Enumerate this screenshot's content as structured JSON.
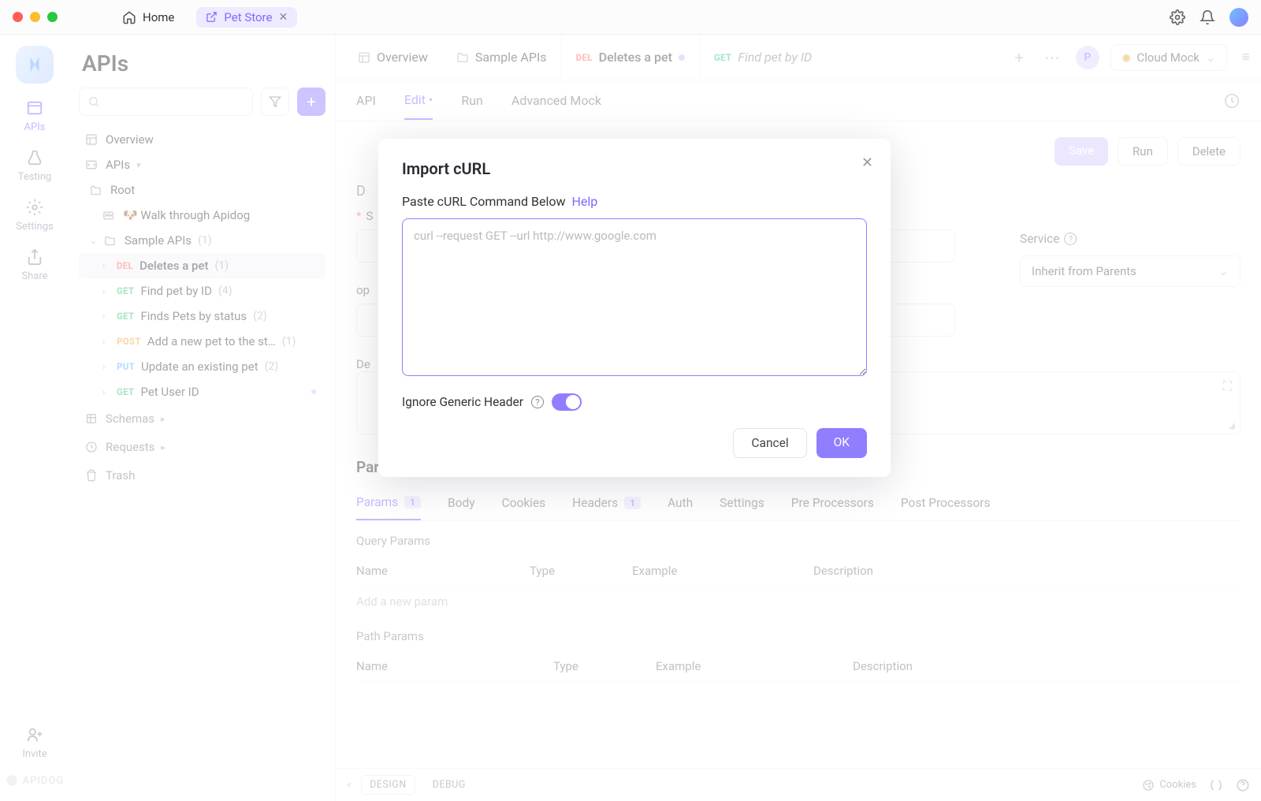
{
  "titlebar": {
    "home": "Home",
    "tab": "Pet Store"
  },
  "iconbar": {
    "apis": "APIs",
    "testing": "Testing",
    "settings": "Settings",
    "share": "Share",
    "invite": "Invite",
    "brand": "APIDOG"
  },
  "sidebar": {
    "title": "APIs",
    "overview": "Overview",
    "apis_label": "APIs",
    "root": "Root",
    "walkthrough": "🐶 Walk through Apidog",
    "sample": {
      "label": "Sample APIs",
      "count": "(1)"
    },
    "endpoints": [
      {
        "method": "DEL",
        "cls": "del",
        "name": "Deletes a pet",
        "count": "(1)",
        "active": true
      },
      {
        "method": "GET",
        "cls": "get",
        "name": "Find pet by ID",
        "count": "(4)"
      },
      {
        "method": "GET",
        "cls": "get",
        "name": "Finds Pets by status",
        "count": "(2)"
      },
      {
        "method": "POST",
        "cls": "post",
        "name": "Add a new pet to the st…",
        "count": "(1)"
      },
      {
        "method": "PUT",
        "cls": "put",
        "name": "Update an existing pet",
        "count": "(2)"
      },
      {
        "method": "GET",
        "cls": "get",
        "name": "Pet User ID",
        "count": "",
        "dot": true
      }
    ],
    "schemas": "Schemas",
    "requests": "Requests",
    "trash": "Trash"
  },
  "tabs": {
    "overview": "Overview",
    "sample": "Sample APIs",
    "del": {
      "m": "DEL",
      "name": "Deletes a pet"
    },
    "get": {
      "m": "GET",
      "name": "Find pet by ID"
    },
    "cloud": "Cloud Mock",
    "avatar": "P"
  },
  "subtabs": {
    "api": "API",
    "edit": "Edit",
    "run": "Run",
    "mock": "Advanced Mock"
  },
  "form": {
    "save": "Save",
    "run": "Run",
    "delete": "Delete",
    "status_label": "S",
    "opid": "op",
    "desc": "De",
    "service": "Service",
    "inherit": "Inherit from Parents"
  },
  "params": {
    "title": "Params",
    "tabs": {
      "params": "Params",
      "params_n": "1",
      "body": "Body",
      "cookies": "Cookies",
      "headers": "Headers",
      "headers_n": "1",
      "auth": "Auth",
      "settings": "Settings",
      "pre": "Pre Processors",
      "post": "Post Processors"
    },
    "query": "Query Params",
    "path": "Path Params",
    "cols": {
      "name": "Name",
      "type": "Type",
      "example": "Example",
      "desc": "Description"
    },
    "add": "Add a new param"
  },
  "bottom": {
    "design": "DESIGN",
    "debug": "DEBUG",
    "cookies": "Cookies"
  },
  "modal": {
    "title": "Import cURL",
    "label": "Paste cURL Command Below",
    "help": "Help",
    "placeholder": "curl --request GET --url http://www.google.com",
    "ignore": "Ignore Generic Header",
    "cancel": "Cancel",
    "ok": "OK"
  }
}
